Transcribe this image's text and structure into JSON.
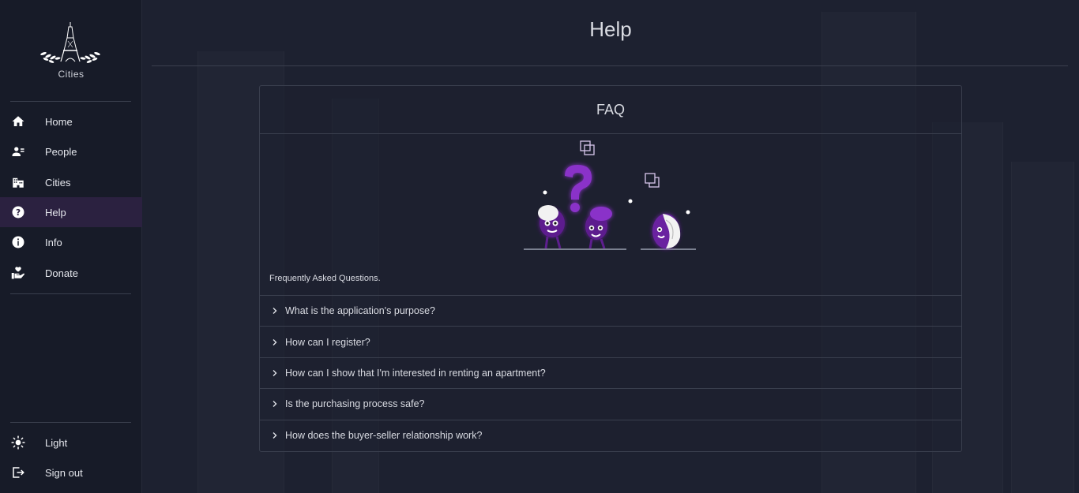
{
  "app": {
    "logo_text": "Cities"
  },
  "page": {
    "title": "Help"
  },
  "sidebar": {
    "items": [
      {
        "label": "Home",
        "icon": "home-icon"
      },
      {
        "label": "People",
        "icon": "people-icon"
      },
      {
        "label": "Cities",
        "icon": "building-icon"
      },
      {
        "label": "Help",
        "icon": "question-icon",
        "active": true
      },
      {
        "label": "Info",
        "icon": "info-icon"
      },
      {
        "label": "Donate",
        "icon": "donate-icon"
      }
    ],
    "bottom": [
      {
        "label": "Light",
        "icon": "sun-icon"
      },
      {
        "label": "Sign out",
        "icon": "sign-out-icon"
      }
    ]
  },
  "faq": {
    "title": "FAQ",
    "subtitle": "Frequently Asked Questions.",
    "questions": [
      "What is the application's purpose?",
      "How can I register?",
      "How can I show that I'm interested in renting an apartment?",
      "Is the purchasing process safe?",
      "How does the buyer-seller relationship work?"
    ]
  },
  "colors": {
    "accent": "#7b2ab8",
    "active_bg": "#2b2140",
    "bg": "#1d2130",
    "sidebar_bg": "#171b28"
  }
}
